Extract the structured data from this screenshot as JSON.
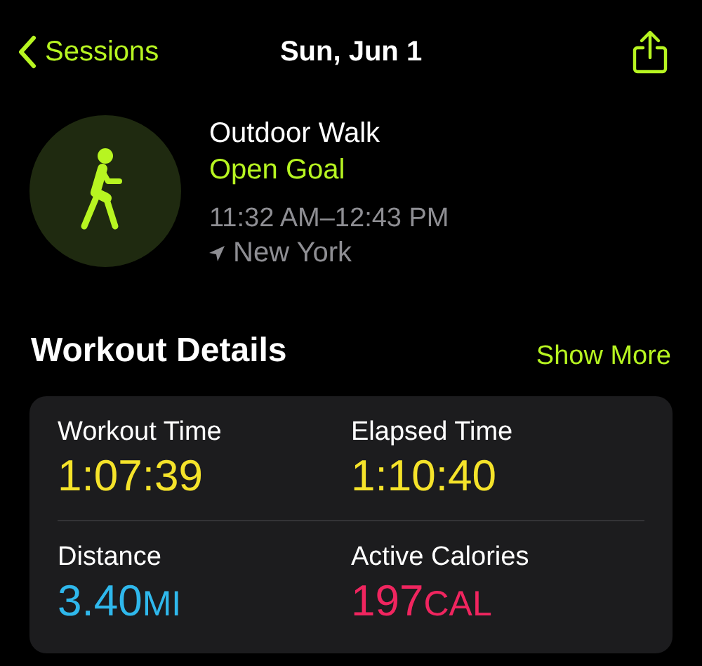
{
  "nav": {
    "back_label": "Sessions",
    "title": "Sun, Jun 1"
  },
  "workout": {
    "name": "Outdoor Walk",
    "goal": "Open Goal",
    "time_range": "11:32 AM–12:43 PM",
    "location": "New York"
  },
  "details": {
    "title": "Workout Details",
    "action": "Show More",
    "rows": [
      [
        {
          "label": "Workout Time",
          "value": "1:07:39",
          "color": "#f5e32a"
        },
        {
          "label": "Elapsed Time",
          "value": "1:10:40",
          "color": "#f5e32a"
        }
      ],
      [
        {
          "label": "Distance",
          "value": "3.40",
          "unit": "MI",
          "color": "#2fb8ec"
        },
        {
          "label": "Active Calories",
          "value": "197",
          "unit": "CAL",
          "color": "#f0255f"
        }
      ]
    ]
  }
}
